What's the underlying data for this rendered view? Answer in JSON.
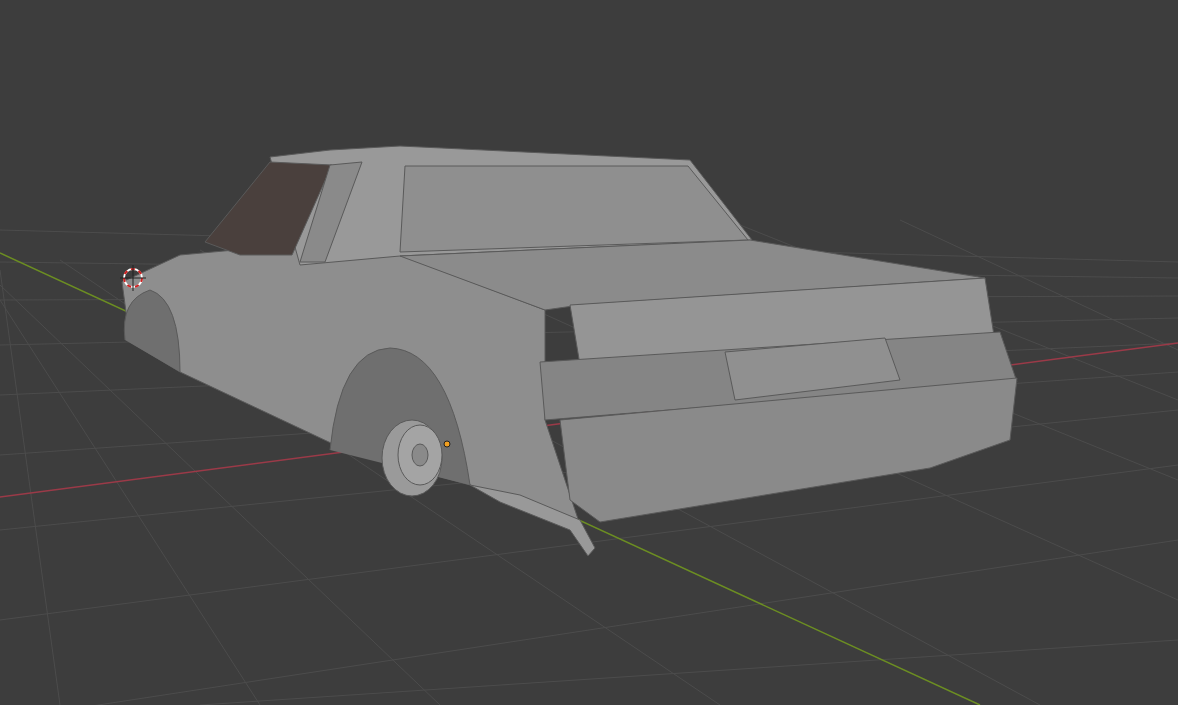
{
  "viewport": {
    "show_grid": true,
    "show_axes": true,
    "cursor_visible": true,
    "object": {
      "selected": true
    }
  }
}
